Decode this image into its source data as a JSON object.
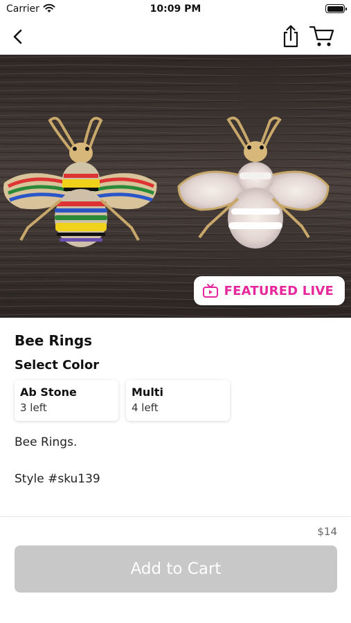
{
  "status_bar": {
    "carrier": "Carrier",
    "time": "10:09 PM"
  },
  "nav": {
    "back_icon": "chevron-left-icon",
    "share_icon": "share-icon",
    "cart_icon": "cart-icon"
  },
  "hero": {
    "badge_label": "FEATURED LIVE",
    "badge_icon": "tv-play-icon",
    "accent_color": "#e6279b"
  },
  "product": {
    "name": "Bee Rings",
    "select_label": "Select Color",
    "options": [
      {
        "name": "Ab Stone",
        "stock": "3 left"
      },
      {
        "name": "Multi",
        "stock": "4 left"
      }
    ],
    "description": "Bee Rings.",
    "style": "Style #sku139"
  },
  "footer": {
    "price": "$14",
    "add_to_cart_label": "Add to Cart",
    "button_color": "#c8c8c8"
  }
}
